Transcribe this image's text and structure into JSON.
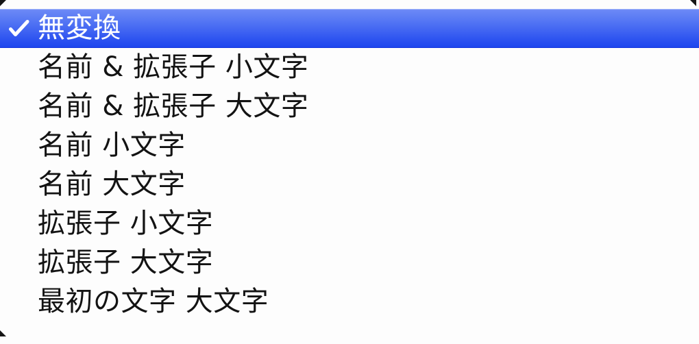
{
  "menu": {
    "name": "filename-case-conversion-menu",
    "background_color": "#fdfdfd",
    "selected_index": 0,
    "highlight_color_top": "#6e8bf5",
    "highlight_color_bottom": "#1e47ee",
    "selected_text_color": "#ffffff",
    "text_color": "#131313",
    "checkmark_icon": "checkmark-icon",
    "items": [
      {
        "label": "無変換",
        "checked": true
      },
      {
        "label": "名前 & 拡張子 小文字",
        "checked": false
      },
      {
        "label": "名前 & 拡張子 大文字",
        "checked": false
      },
      {
        "label": "名前 小文字",
        "checked": false
      },
      {
        "label": "名前 大文字",
        "checked": false
      },
      {
        "label": "拡張子 小文字",
        "checked": false
      },
      {
        "label": "拡張子 大文字",
        "checked": false
      },
      {
        "label": "最初の文字 大文字",
        "checked": false
      }
    ]
  }
}
